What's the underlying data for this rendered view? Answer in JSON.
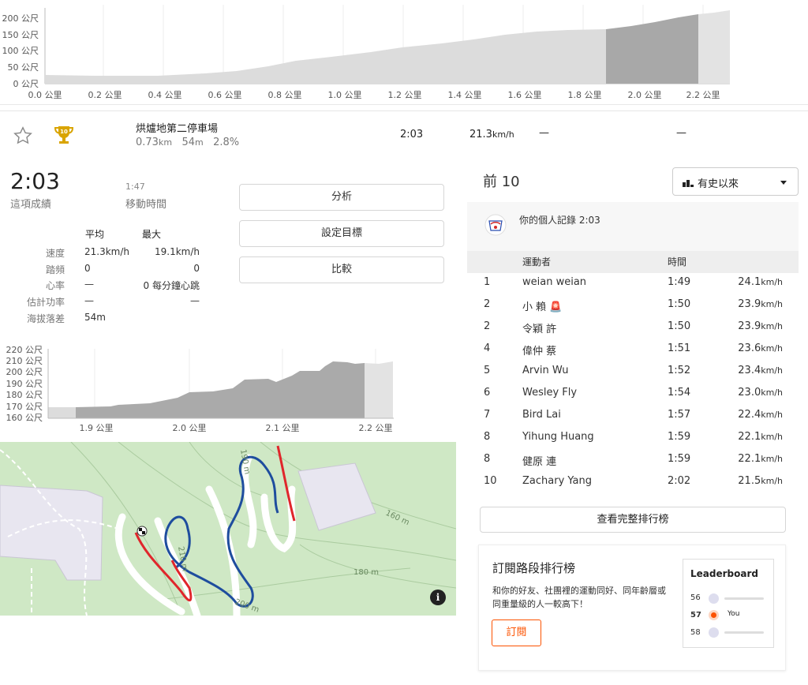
{
  "top_chart": {
    "y_ticks": [
      "200 公尺",
      "150 公尺",
      "100 公尺",
      "50 公尺",
      "0 公尺"
    ],
    "x_ticks": [
      "0.0 公里",
      "0.2 公里",
      "0.4 公里",
      "0.6 公里",
      "0.8 公里",
      "1.0 公里",
      "1.2 公里",
      "1.4 公里",
      "1.6 公里",
      "1.8 公里",
      "2.0 公里",
      "2.2 公里"
    ]
  },
  "segment": {
    "name": "烘爐地第二停車場",
    "distance": "0.73",
    "distance_unit": "km",
    "elev": "54",
    "elev_unit": "m",
    "grade": "2.8%",
    "time": "2:03",
    "speed": "21.3",
    "speed_unit": "km/h",
    "dash1": "—",
    "dash2": "—",
    "trophy_rank": "10"
  },
  "effort": {
    "time": "2:03",
    "time_label": "這項成績",
    "moving_time": "1:47",
    "moving_label": "移動時間",
    "hdr_avg": "平均",
    "hdr_max": "最大",
    "rows": [
      {
        "label": "速度",
        "avg": "21.3km/h",
        "max": "19.1km/h"
      },
      {
        "label": "踏頻",
        "avg": "0",
        "max": "0"
      },
      {
        "label": "心率",
        "avg": "—",
        "max": "0 每分鐘心跳"
      },
      {
        "label": "估計功率",
        "avg": "—",
        "max": "—"
      },
      {
        "label": "海拔落差",
        "avg": "54m",
        "max": ""
      }
    ]
  },
  "buttons": {
    "analyze": "分析",
    "set_goal": "設定目標",
    "compare": "比較"
  },
  "mini_chart": {
    "y_ticks": [
      "220 公尺",
      "210 公尺",
      "200 公尺",
      "190 公尺",
      "180 公尺",
      "170 公尺",
      "160 公尺"
    ],
    "x_ticks": [
      "1.9 公里",
      "2.0 公里",
      "2.1 公里",
      "2.2 公里"
    ]
  },
  "map": {
    "labels": [
      "160 m",
      "180 m",
      "210 m",
      "200 m",
      "190 m"
    ],
    "info": "i",
    "colors": {
      "route_red": "#e0262b",
      "route_blue": "#1e4d9e",
      "land": "#cfe8c5",
      "building": "#e8e6f0"
    }
  },
  "leaderboard": {
    "title": "前 10",
    "filter": "有史以來",
    "pr_text": "你的個人記錄 2:03",
    "col_athlete": "運動者",
    "col_time": "時間",
    "rows": [
      {
        "rank": "1",
        "name": "weian weian",
        "time": "1:49",
        "speed": "24.1",
        "unit": "km/h"
      },
      {
        "rank": "2",
        "name": "小 賴 🚨",
        "time": "1:50",
        "speed": "23.9",
        "unit": "km/h"
      },
      {
        "rank": "2",
        "name": "令穎 許",
        "time": "1:50",
        "speed": "23.9",
        "unit": "km/h"
      },
      {
        "rank": "4",
        "name": "偉仲 蔡",
        "time": "1:51",
        "speed": "23.6",
        "unit": "km/h"
      },
      {
        "rank": "5",
        "name": "Arvin Wu",
        "time": "1:52",
        "speed": "23.4",
        "unit": "km/h"
      },
      {
        "rank": "6",
        "name": "Wesley Fly",
        "time": "1:54",
        "speed": "23.0",
        "unit": "km/h"
      },
      {
        "rank": "7",
        "name": "Bird Lai",
        "time": "1:57",
        "speed": "22.4",
        "unit": "km/h"
      },
      {
        "rank": "8",
        "name": "Yihung Huang",
        "time": "1:59",
        "speed": "22.1",
        "unit": "km/h"
      },
      {
        "rank": "8",
        "name": "健原 連",
        "time": "1:59",
        "speed": "22.1",
        "unit": "km/h"
      },
      {
        "rank": "10",
        "name": "Zachary Yang",
        "time": "2:02",
        "speed": "21.5",
        "unit": "km/h"
      }
    ],
    "full_button": "查看完整排行榜"
  },
  "subscribe": {
    "title": "訂閱路段排行榜",
    "desc": "和你的好友、社團裡的運動同好、同年齡層或同重量級的人一較高下！",
    "button": "訂閱",
    "card_title": "Leaderboard",
    "ranks": [
      "56",
      "57",
      "58"
    ],
    "you": "You",
    "accent": "#fc5200"
  }
}
